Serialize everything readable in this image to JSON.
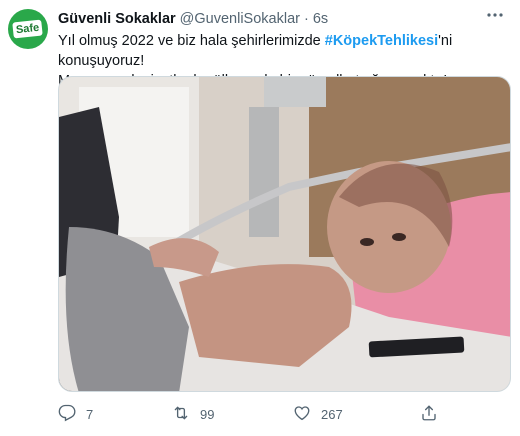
{
  "tweet": {
    "author_name": "Güvenli Sokaklar",
    "handle": "@GuvenliSokaklar",
    "separator": "·",
    "time": "6s",
    "avatar_text": "Safe",
    "text_line1_before": "Yıl olmuş 2022 ve biz hala şehirlerimizde ",
    "hashtag": "#KöpekTehlikesi",
    "text_line1_after": "'ni konuşuyoruz!",
    "text_line2": "Muasır medeniyetler bu ülkeye de bir gün elbet uğrayacaktır!"
  },
  "actions": {
    "replies": "7",
    "retweets": "99",
    "likes": "267"
  },
  "icons": {
    "more": "more-dots-icon",
    "reply": "reply-icon",
    "retweet": "retweet-icon",
    "like": "heart-icon",
    "share": "share-icon"
  },
  "colors": {
    "accent": "#1d9bf0",
    "muted": "#536471",
    "avatar_bg": "#2aa84a"
  }
}
